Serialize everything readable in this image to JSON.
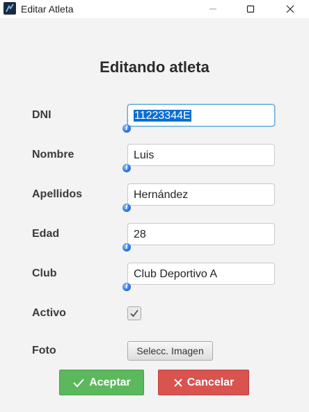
{
  "window": {
    "title": "Editar Atleta",
    "controls": [
      "minimize-icon",
      "maximize-icon",
      "close-icon"
    ]
  },
  "form": {
    "heading": "Editando atleta",
    "fields": {
      "dni": {
        "label": "DNI",
        "value": "11223344E"
      },
      "nombre": {
        "label": "Nombre",
        "value": "Luis"
      },
      "apellidos": {
        "label": "Apellidos",
        "value": "Hernández"
      },
      "edad": {
        "label": "Edad",
        "value": "28"
      },
      "club": {
        "label": "Club",
        "value": "Club Deportivo A"
      }
    },
    "activo": {
      "label": "Activo",
      "checked": true
    },
    "foto": {
      "label": "Foto",
      "button": "Selecc. Imagen"
    }
  },
  "actions": {
    "accept": "Aceptar",
    "cancel": "Cancelar"
  },
  "colors": {
    "accept": "#5cb85c",
    "cancel": "#d9534f",
    "focus_border": "#5fa8d8",
    "selection": "#0a6fd1"
  }
}
